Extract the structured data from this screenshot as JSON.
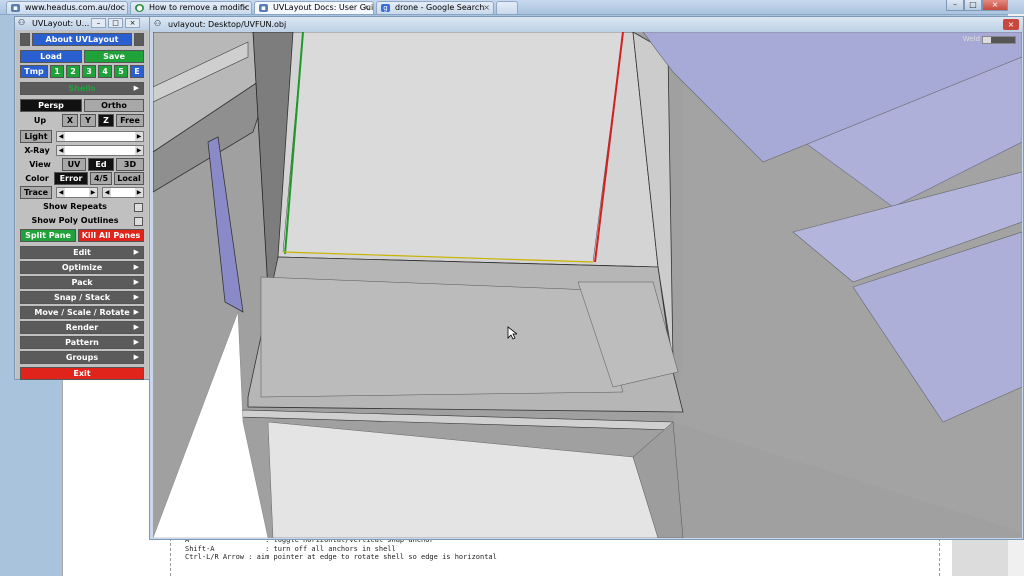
{
  "browser": {
    "tabs": [
      {
        "label": "www.headus.com.au/doc",
        "icon": "page-icon",
        "color": "#5a7fb0"
      },
      {
        "label": "How to remove a modific",
        "icon": "stack-icon",
        "color": "#2f8f3c"
      },
      {
        "label": "UVLayout Docs: User Guid",
        "icon": "page-icon",
        "color": "#5a7fb0"
      },
      {
        "label": "drone - Google Search",
        "icon": "google-icon",
        "color": "#3b6fd8"
      }
    ]
  },
  "document": {
    "help_lines": [
      "A                  : toggle horizontal/vertical snap anchor",
      "Shift-A            : turn off all anchors in shell",
      "",
      "Ctrl-L/R Arrow : aim pointer at edge to rotate shell so edge is horizontal"
    ]
  },
  "viewport": {
    "title": "uvlayout: Desktop/UVFUN.obj",
    "weld_label": "Weld",
    "weld_level": 0.25,
    "close_icon": "close-icon"
  },
  "panel": {
    "title": "UVLayout: U...",
    "about": "About UVLayout",
    "load": "Load",
    "save": "Save",
    "tmp": "Tmp",
    "tmp_slots": [
      "1",
      "2",
      "3",
      "4",
      "5",
      "E"
    ],
    "shells_label": "Shells",
    "persp": "Persp",
    "ortho": "Ortho",
    "up": "Up",
    "up_options": [
      "X",
      "Y",
      "Z",
      "Free"
    ],
    "light": "Light",
    "xray": "X-Ray",
    "view": "View",
    "view_options": [
      "UV",
      "Ed",
      "3D"
    ],
    "color": "Color",
    "color_options": [
      "Error",
      "4/5",
      "Local"
    ],
    "trace": "Trace",
    "show_repeats": "Show Repeats",
    "show_poly_outlines": "Show Poly Outlines",
    "split_pane": "Split Pane",
    "kill_all_panes": "Kill All Panes",
    "menus": [
      "Edit",
      "Optimize",
      "Pack",
      "Snap / Stack",
      "Move / Scale / Rotate",
      "Render",
      "Pattern",
      "Groups"
    ],
    "exit": "Exit"
  },
  "colors": {
    "blue_button": "#2a5fd0",
    "green_button": "#1fa23a",
    "red_button": "#e0241b",
    "panel_bg": "#c0c0c0"
  }
}
